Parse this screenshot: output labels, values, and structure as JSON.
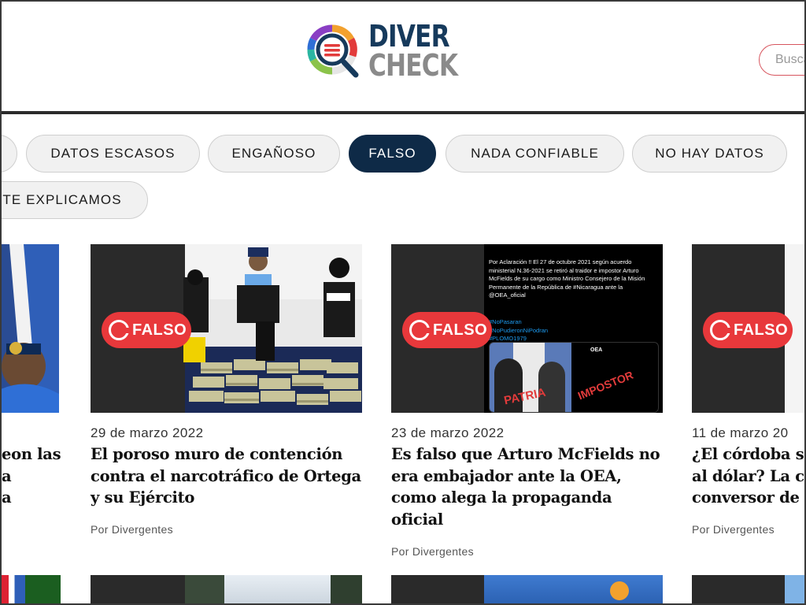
{
  "header": {
    "logo_line1": "DIVER",
    "logo_line2": "CHECK",
    "search_placeholder": "Buscar"
  },
  "filters": [
    {
      "label": "",
      "active": false
    },
    {
      "label": "DATOS ESCASOS",
      "active": false
    },
    {
      "label": "ENGAÑOSO",
      "active": false
    },
    {
      "label": "FALSO",
      "active": true
    },
    {
      "label": "NADA CONFIABLE",
      "active": false
    },
    {
      "label": "NO HAY DATOS",
      "active": false
    },
    {
      "label": "TE EXPLICAMOS",
      "active": false
    }
  ],
  "badge_label": "FALSO",
  "cards": [
    {
      "date": "",
      "title": "eon las\na\na",
      "author": ""
    },
    {
      "date": "29 de marzo 2022",
      "title": "El poroso muro de contención contra el narcotráfico de Ortega y su Ejército",
      "author": "Por Divergentes"
    },
    {
      "date": "23 de marzo 2022",
      "title": "Es falso que Arturo McFields no era embajador ante la OEA, como alega la propaganda oficial",
      "author": "Por Divergentes"
    },
    {
      "date": "11 de marzo 20",
      "title": "¿El córdoba s al dólar? La c conversor de",
      "author": "Por Divergentes"
    }
  ],
  "tweet": {
    "text": "Por Aclaración ‼ El 27 de octubre 2021 según acuerdo ministerial N.36-2021 se retiró al traidor e impostor Arturo McFields de su cargo como Ministro Consejero de la Misión Permanente de la República de #Nicaragua ante la @OEA_oficial",
    "tags": "#NoPasaran\n#NoPudieronNiPodran\n#PLOMO1979",
    "quoted_account": "OEA",
    "stamp1": "PATRIA",
    "stamp2": "IMPOSTOR"
  },
  "colors": {
    "brand_navy": "#163a5c",
    "chip_active": "#0e2a47",
    "badge_red": "#e8383b",
    "search_border": "#d7555e"
  }
}
